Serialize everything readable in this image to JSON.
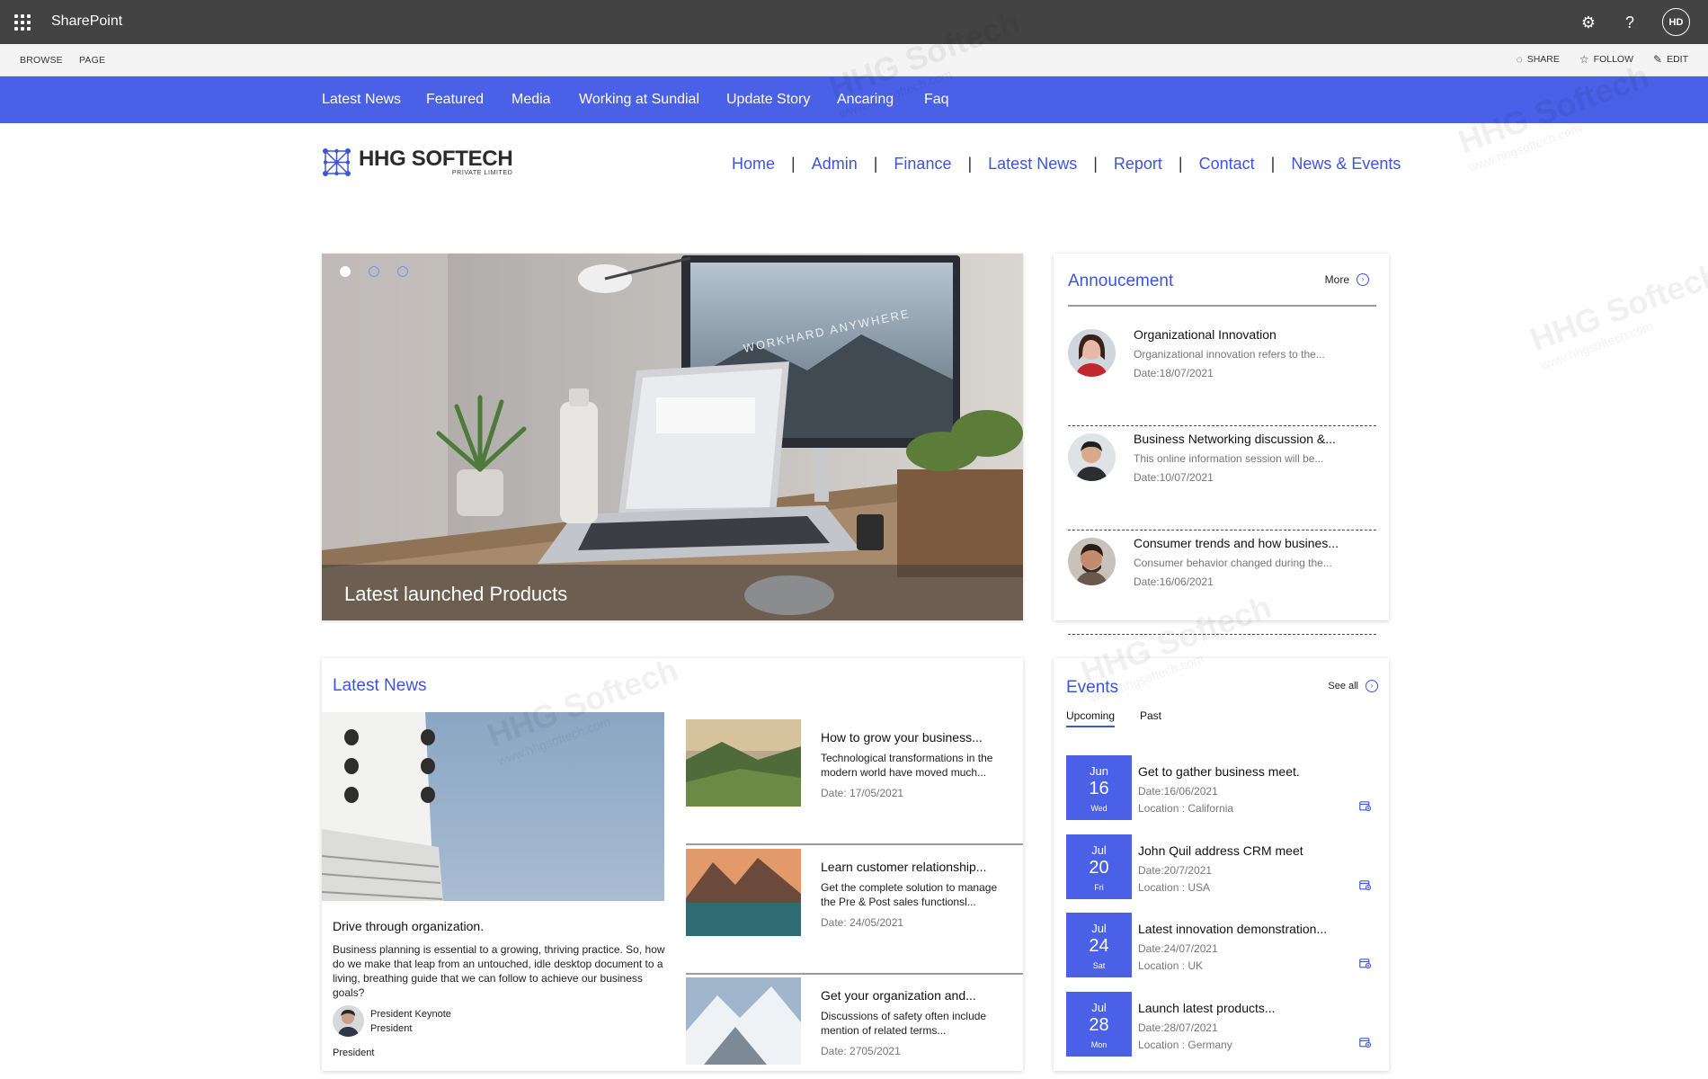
{
  "suite": {
    "title": "SharePoint",
    "avatar_initials": "HD",
    "icons": [
      "waffle-icon",
      "gear-icon",
      "help-icon"
    ]
  },
  "ribbon": {
    "tabs": [
      "BROWSE",
      "PAGE"
    ],
    "actions": [
      {
        "label": "SHARE",
        "icon": "share-icon"
      },
      {
        "label": "FOLLOW",
        "icon": "star-icon"
      },
      {
        "label": "EDIT",
        "icon": "pencil-icon"
      }
    ]
  },
  "topnav": [
    "Latest News",
    "Featured",
    "Media",
    "Working at Sundial",
    "Update Story",
    "Ancaring",
    "Faq"
  ],
  "logo": {
    "name": "HHG SOFTECH",
    "sub": "PRIVATE LIMITED"
  },
  "mainnav": [
    "Home",
    "Admin",
    "Finance",
    "Latest News",
    "Report",
    "Contact",
    "News & Events"
  ],
  "hero": {
    "caption": "Latest launched Products",
    "screen_text": "WORKHARD ANYWHERE",
    "slides": 3,
    "active_slide": 1
  },
  "announcement": {
    "title": "Annoucement",
    "more_label": "More",
    "items": [
      {
        "title": "Organizational Innovation",
        "desc": "Organizational innovation refers to the...",
        "date": "Date:18/07/2021"
      },
      {
        "title": "Business Networking discussion &...",
        "desc": "This online information session will be...",
        "date": "Date:10/07/2021"
      },
      {
        "title": "Consumer trends and how busines...",
        "desc": "Consumer behavior changed during the...",
        "date": "Date:16/06/2021"
      }
    ]
  },
  "news": {
    "title": "Latest News",
    "feature": {
      "title": "Drive through organization.",
      "text": "Business planning is essential to a growing, thriving practice. So, how do we make that leap from an untouched, idle desktop document to a living, breathing guide that we can follow to achieve our business goals?",
      "author": "President Keynote",
      "role": "President",
      "footer": "President"
    },
    "items": [
      {
        "title": "How to grow your  business...",
        "desc": "Technological transformations in the modern world have moved much...",
        "date": "Date: 17/05/2021"
      },
      {
        "title": "Learn customer relationship...",
        "desc": "Get the complete solution to manage the Pre & Post sales functionsl...",
        "date": "Date: 24/05/2021"
      },
      {
        "title": "Get your organization and...",
        "desc": "Discussions of safety often include mention of related terms...",
        "date": "Date: 2705/2021"
      }
    ]
  },
  "events": {
    "title": "Events",
    "see_all_label": "See all",
    "tabs": [
      "Upcoming",
      "Past"
    ],
    "active_tab": "Upcoming",
    "items": [
      {
        "month": "Jun",
        "day": "16",
        "weekday": "Wed",
        "title": "Get to gather business meet.",
        "date": "Date:16/06/2021",
        "location": "Location : California"
      },
      {
        "month": "Jul",
        "day": "20",
        "weekday": "Fri",
        "title": "John Quil address CRM meet",
        "date": "Date:20/7/2021",
        "location": "Location : USA"
      },
      {
        "month": "Jul",
        "day": "24",
        "weekday": "Sat",
        "title": "Latest innovation demonstration...",
        "date": "Date:24/07/2021",
        "location": "Location : UK"
      },
      {
        "month": "Jul",
        "day": "28",
        "weekday": "Mon",
        "title": "Launch  latest products...",
        "date": "Date:28/07/2021",
        "location": "Location : Germany"
      }
    ]
  },
  "watermark": {
    "brand": "HHG Softech",
    "url": "www.hhgsoftech.com"
  },
  "colors": {
    "accent": "#4a60e6",
    "link": "#3e55d8",
    "suitebar": "#434343"
  }
}
